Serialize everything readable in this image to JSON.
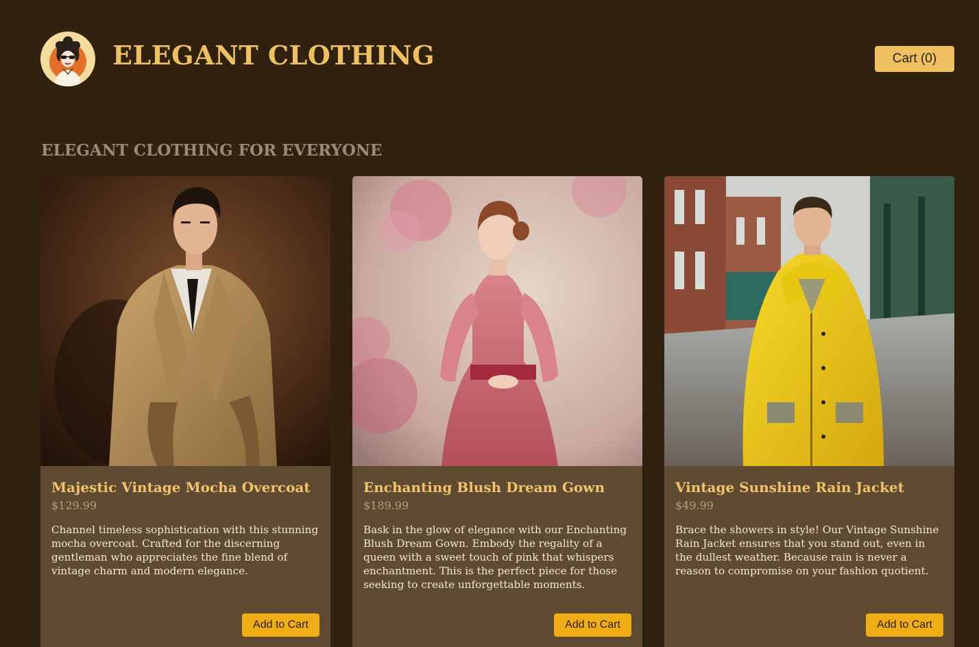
{
  "header": {
    "logo_icon": "vintage-woman-portrait-logo",
    "brand_title": "ELEGANT CLOTHING",
    "cart_label": "Cart (0)"
  },
  "section": {
    "title": "ELEGANT CLOTHING FOR EVERYONE"
  },
  "products": [
    {
      "image_icon": "man-in-trench-coat-photo",
      "name": "Majestic Vintage Mocha Overcoat",
      "price": "$129.99",
      "description": "Channel timeless sophistication with this stunning mocha overcoat. Crafted for the discerning gentleman who appreciates the fine blend of vintage charm and modern elegance.",
      "button_label": "Add to Cart"
    },
    {
      "image_icon": "woman-in-pink-gown-photo",
      "name": "Enchanting Blush Dream Gown",
      "price": "$189.99",
      "description": "Bask in the glow of elegance with our Enchanting Blush Dream Gown. Embody the regality of a queen with a sweet touch of pink that whispers enchantment. This is the perfect piece for those seeking to create unforgettable moments.",
      "button_label": "Add to Cart"
    },
    {
      "image_icon": "man-in-yellow-raincoat-photo",
      "name": "Vintage Sunshine Rain Jacket",
      "price": "$49.99",
      "description": "Brace the showers in style! Our Vintage Sunshine Rain Jacket ensures that you stand out, even in the dullest weather. Because rain is never a reason to compromise on your fashion quotient.",
      "button_label": "Add to Cart"
    }
  ],
  "colors": {
    "page_background": "#30220e",
    "card_background": "#5e4b31",
    "accent_gold": "#efc061",
    "button_amber": "#f1ad15",
    "product_name": "#f2c36c"
  }
}
